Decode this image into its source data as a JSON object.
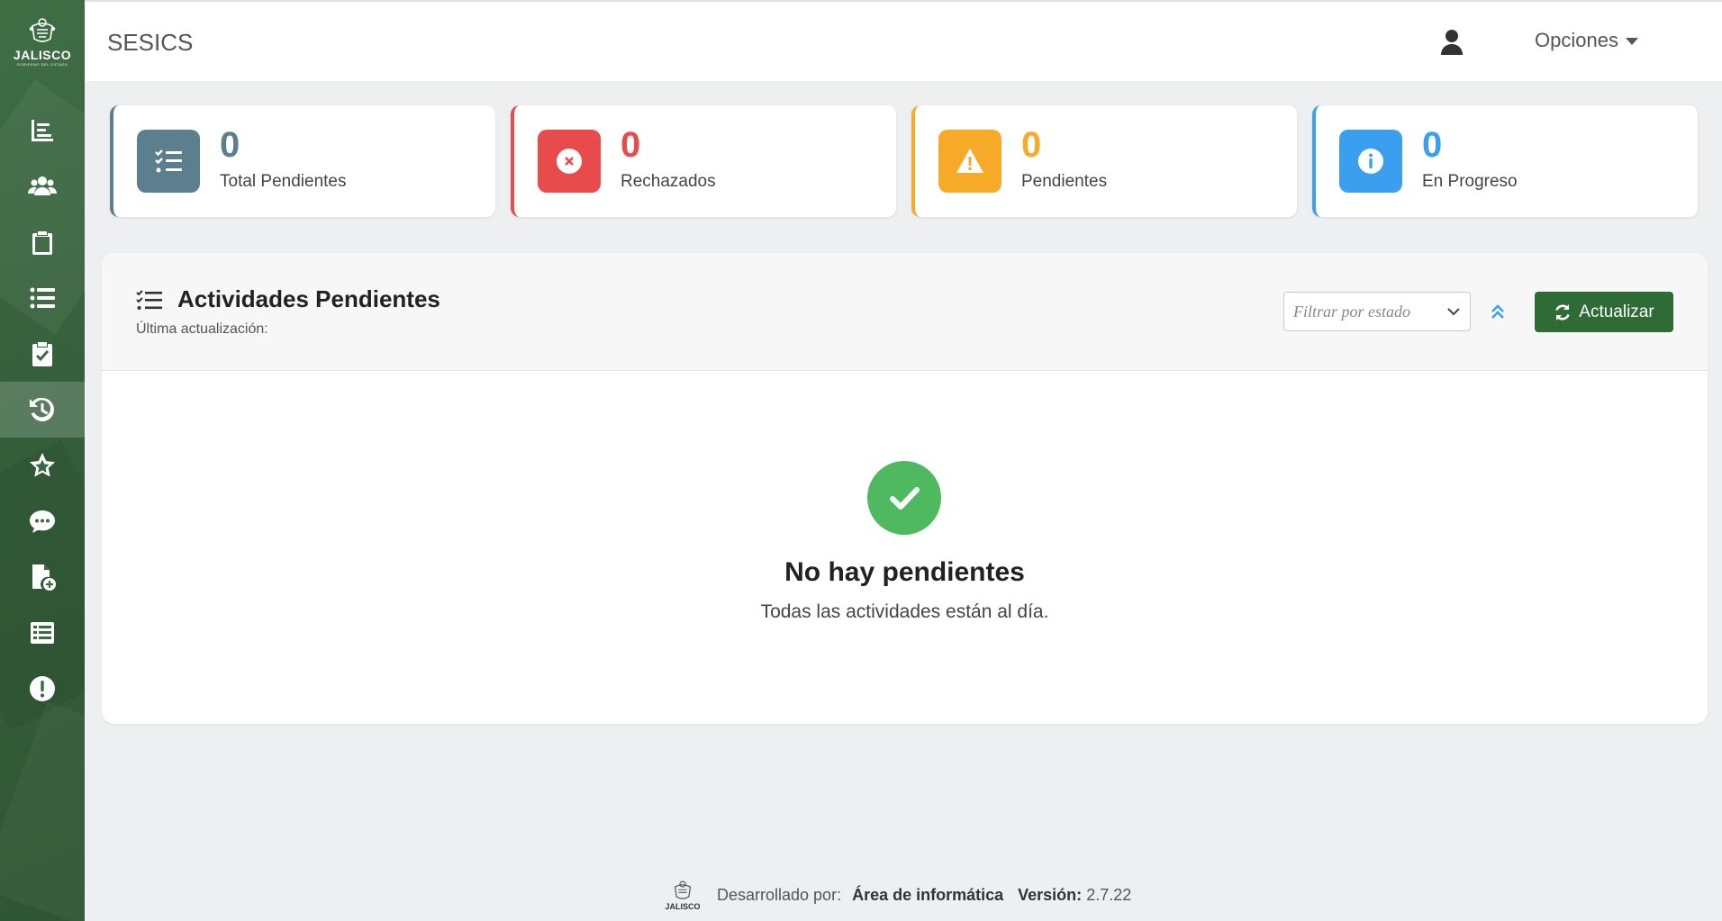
{
  "sidebar": {
    "logo_text": "JALISCO",
    "logo_sub": "GOBIERNO DEL ESTADO",
    "items": [
      {
        "icon": "chart-icon",
        "active": false
      },
      {
        "icon": "users-icon",
        "active": false
      },
      {
        "icon": "clipboard-icon",
        "active": false
      },
      {
        "icon": "list-icon",
        "active": false
      },
      {
        "icon": "clipboard-check-icon",
        "active": false
      },
      {
        "icon": "history-icon",
        "active": true
      },
      {
        "icon": "star-icon",
        "active": false
      },
      {
        "icon": "chat-icon",
        "active": false
      },
      {
        "icon": "file-add-icon",
        "active": false
      },
      {
        "icon": "table-list-icon",
        "active": false
      },
      {
        "icon": "alert-icon",
        "active": false
      }
    ]
  },
  "header": {
    "title": "SESICS",
    "options_label": "Opciones"
  },
  "stats": [
    {
      "count": "0",
      "label": "Total Pendientes",
      "color": "#5c7f8e"
    },
    {
      "count": "0",
      "label": "Rechazados",
      "color": "#e84b4b"
    },
    {
      "count": "0",
      "label": "Pendientes",
      "color": "#f7a928"
    },
    {
      "count": "0",
      "label": "En Progreso",
      "color": "#3a9fef"
    }
  ],
  "panel": {
    "title": "Actividades Pendientes",
    "subtitle": "Última actualización:",
    "filter_placeholder": "Filtrar por estado",
    "refresh_label": "Actualizar",
    "empty_title": "No hay pendientes",
    "empty_message": "Todas las actividades están al día."
  },
  "footer": {
    "logo_text": "JALISCO",
    "developed_label": "Desarrollado por:",
    "developer": "Área de informática",
    "version_label": "Versión:",
    "version": "2.7.22"
  },
  "colors": {
    "brand_green": "#2e6b35",
    "sidebar_green": "#3a6a41",
    "success": "#4fb960",
    "link_blue": "#3a9fef"
  }
}
